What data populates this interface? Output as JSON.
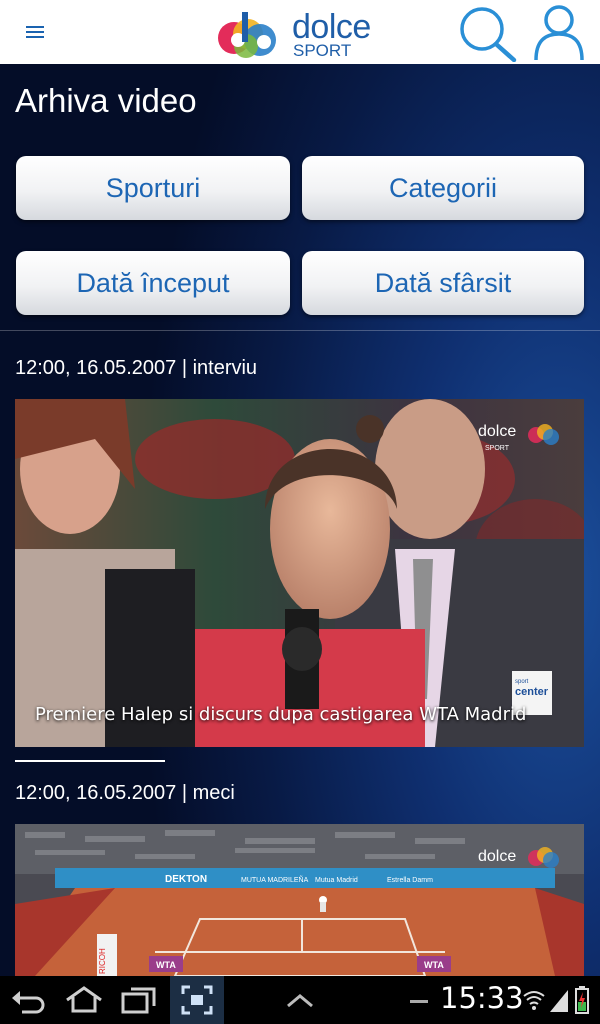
{
  "header": {
    "brand": "dolce",
    "brand_sub": "SPORT",
    "colors": {
      "brand_blue": "#1f5ea8",
      "menu_blue": "#1a63b0"
    }
  },
  "page": {
    "title": "Arhiva video"
  },
  "filters": {
    "sports": "Sporturi",
    "categories": "Categorii",
    "start_date": "Dată început",
    "end_date": "Dată sfârsit"
  },
  "videos": [
    {
      "meta": "12:00, 16.05.2007 | interviu",
      "caption": "Premiere Halep si discurs dupa castigarea WTA Madrid"
    },
    {
      "meta": "12:00, 16.05.2007 | meci",
      "caption": ""
    }
  ],
  "overlays": {
    "channel": "dolce",
    "channel_sub": "SPORT",
    "sponsor_top": "sport",
    "sponsor_main": "center"
  },
  "stadium_boards": [
    "DEKTON",
    "MUTUA MADRILEÑA",
    "Mutua Madrid",
    "Estrella Damm",
    "WTA",
    "RICOH"
  ],
  "status_bar": {
    "time": "15:33"
  },
  "icons": [
    "menu-icon",
    "search-icon",
    "user-icon",
    "back-icon",
    "home-icon",
    "recent-apps-icon",
    "screenshot-icon",
    "up-chevron-icon",
    "wifi-icon",
    "signal-icon",
    "battery-icon"
  ]
}
